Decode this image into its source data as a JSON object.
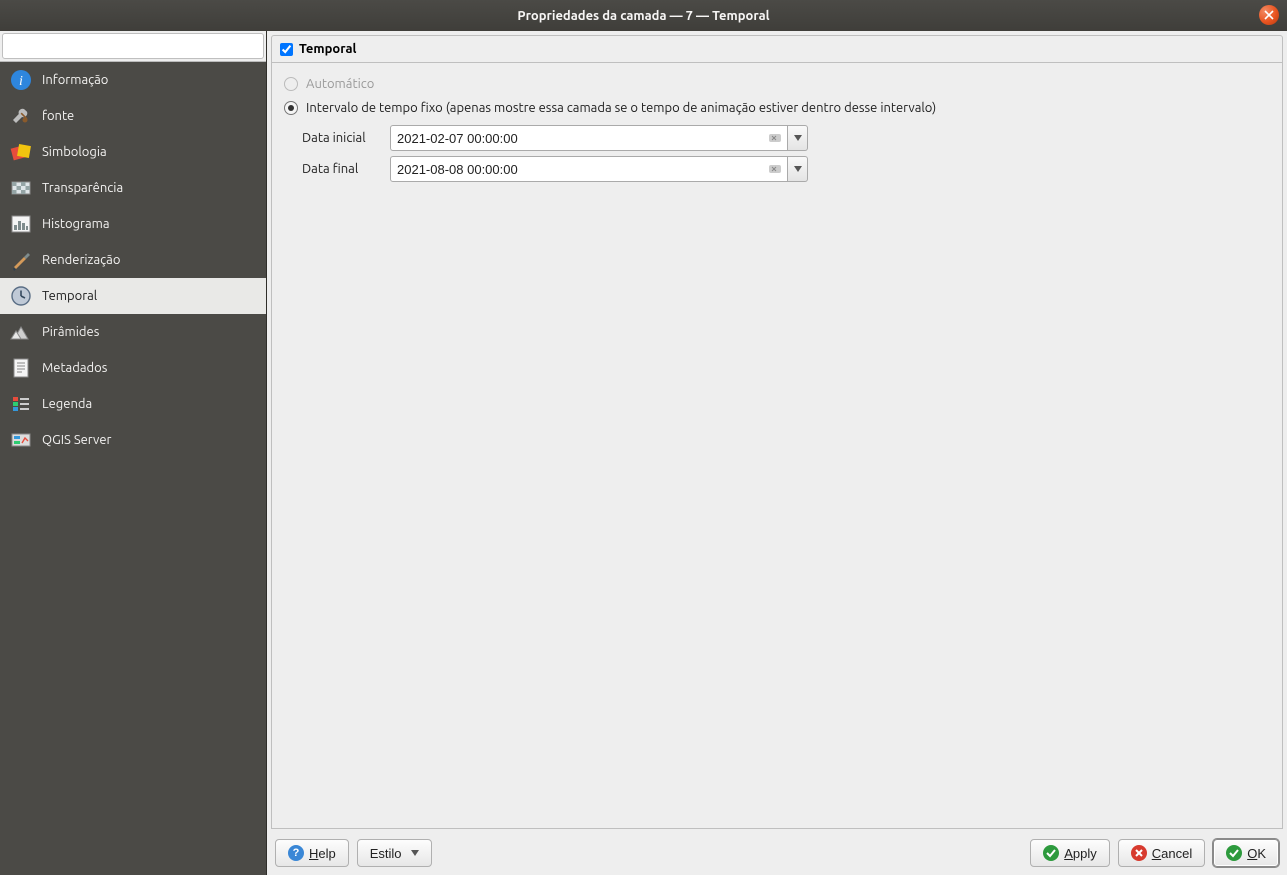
{
  "window": {
    "title": "Propriedades da camada — 7 — Temporal"
  },
  "search": {
    "placeholder": ""
  },
  "sidebar": {
    "items": [
      {
        "id": "informacao",
        "label": "Informação"
      },
      {
        "id": "fonte",
        "label": "fonte"
      },
      {
        "id": "simbologia",
        "label": "Simbologia"
      },
      {
        "id": "transparencia",
        "label": "Transparência"
      },
      {
        "id": "histograma",
        "label": "Histograma"
      },
      {
        "id": "renderizacao",
        "label": "Renderização"
      },
      {
        "id": "temporal",
        "label": "Temporal",
        "active": true
      },
      {
        "id": "piramides",
        "label": "Pirâmides"
      },
      {
        "id": "metadados",
        "label": "Metadados"
      },
      {
        "id": "legenda",
        "label": "Legenda"
      },
      {
        "id": "qgisserver",
        "label": "QGIS Server"
      }
    ]
  },
  "panel": {
    "group_label": "Temporal",
    "group_checked": true,
    "radios": {
      "automatic": {
        "label": "Automático",
        "selected": false,
        "disabled": true
      },
      "fixed": {
        "label": "Intervalo de tempo fixo (apenas mostre essa camada se o tempo de animação estiver dentro desse intervalo)",
        "selected": true,
        "disabled": false
      }
    },
    "fields": {
      "start_label": "Data inicial",
      "start_value": "2021-02-07 00:00:00",
      "end_label": "Data final",
      "end_value": "2021-08-08 00:00:00"
    }
  },
  "footer": {
    "help": "Help",
    "style": "Estilo",
    "apply": "Apply",
    "cancel": "Cancel",
    "ok": "OK"
  }
}
